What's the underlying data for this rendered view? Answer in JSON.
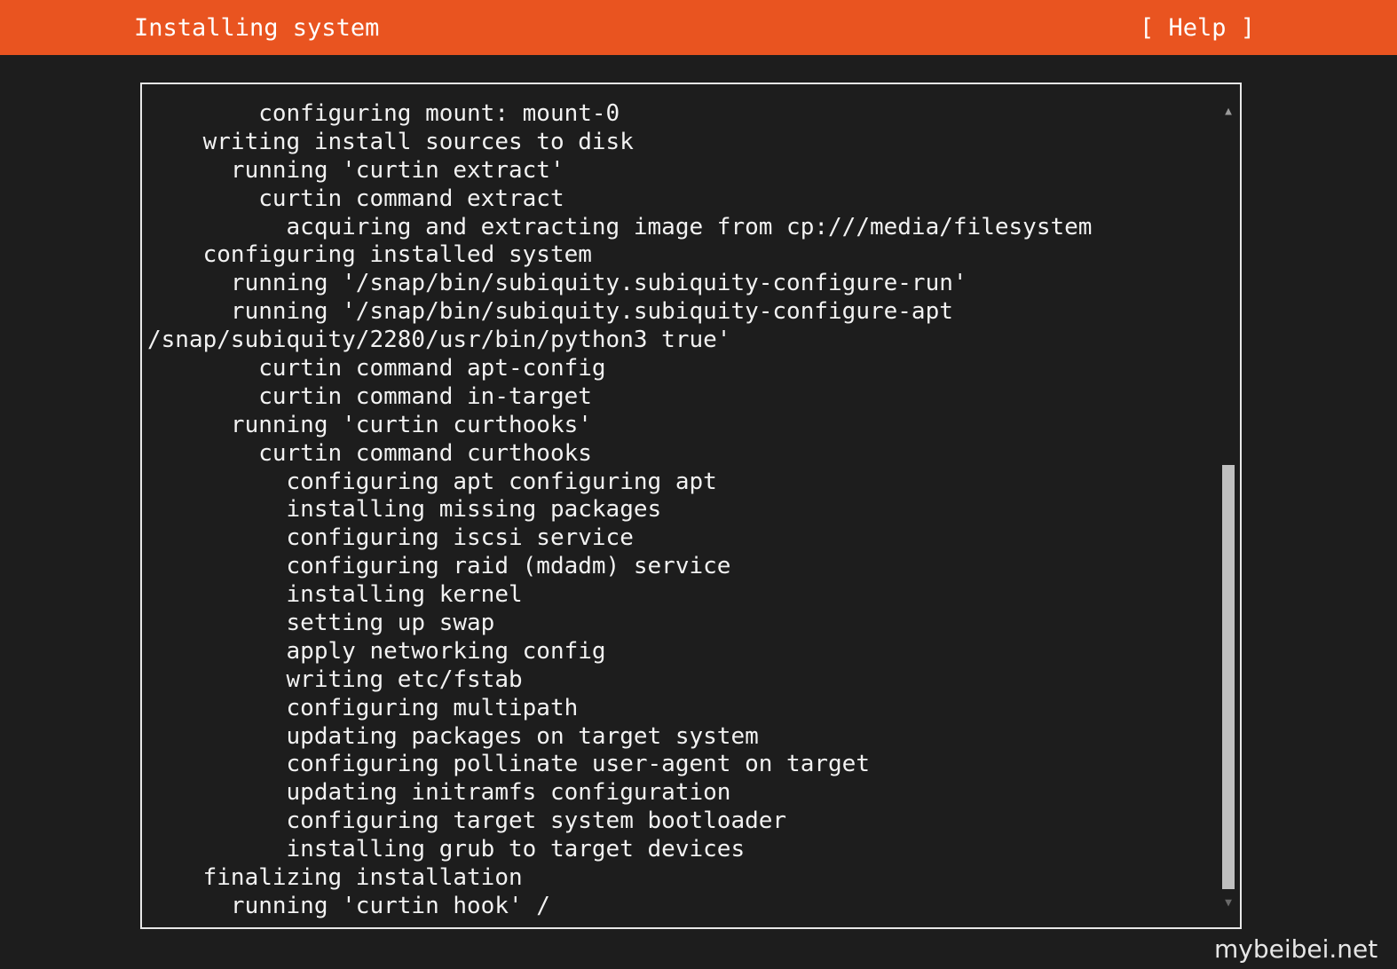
{
  "header": {
    "title": "Installing system",
    "help_label": "[ Help ]"
  },
  "colors": {
    "accent": "#e95420",
    "background": "#1d1d1d",
    "text": "#f0f0f0"
  },
  "log": {
    "lines": [
      "        configuring mount: mount-0",
      "    writing install sources to disk",
      "      running 'curtin extract'",
      "        curtin command extract",
      "          acquiring and extracting image from cp:///media/filesystem",
      "    configuring installed system",
      "      running '/snap/bin/subiquity.subiquity-configure-run'",
      "      running '/snap/bin/subiquity.subiquity-configure-apt",
      "/snap/subiquity/2280/usr/bin/python3 true'",
      "        curtin command apt-config",
      "        curtin command in-target",
      "      running 'curtin curthooks'",
      "        curtin command curthooks",
      "          configuring apt configuring apt",
      "          installing missing packages",
      "          configuring iscsi service",
      "          configuring raid (mdadm) service",
      "          installing kernel",
      "          setting up swap",
      "          apply networking config",
      "          writing etc/fstab",
      "          configuring multipath",
      "          updating packages on target system",
      "          configuring pollinate user-agent on target",
      "          updating initramfs configuration",
      "          configuring target system bootloader",
      "          installing grub to target devices",
      "    finalizing installation",
      "      running 'curtin hook' /"
    ]
  },
  "scrollbar": {
    "up_icon": "arrow-up-icon",
    "down_icon": "arrow-down-icon",
    "up_glyph": "▲",
    "down_glyph": "▼"
  },
  "watermark": "mybeibei.net"
}
